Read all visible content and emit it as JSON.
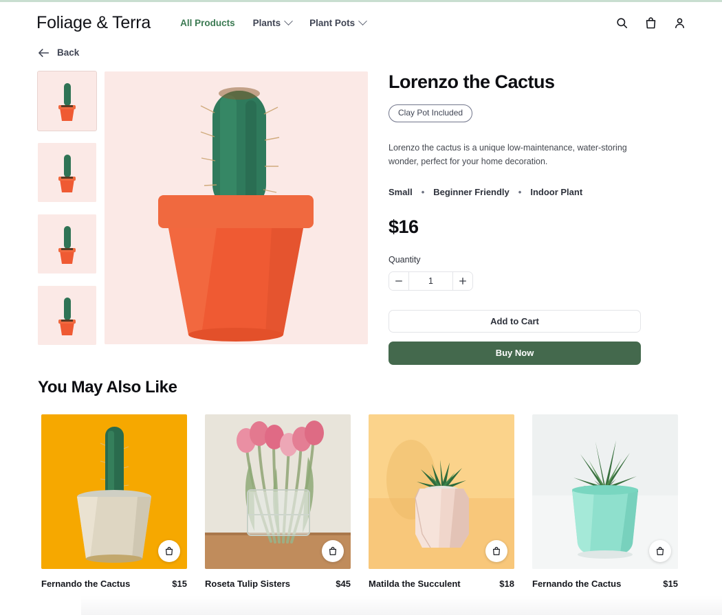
{
  "brand": "Foliage & Terra",
  "nav": {
    "items": [
      {
        "label": "All Products",
        "active": true,
        "caret": false
      },
      {
        "label": "Plants",
        "active": false,
        "caret": true
      },
      {
        "label": "Plant Pots",
        "active": false,
        "caret": true
      }
    ],
    "icons": [
      "search-icon",
      "shopping-bag-icon",
      "account-icon"
    ]
  },
  "back": {
    "label": "Back",
    "icon": "arrow-left-icon"
  },
  "gallery": {
    "thumbnail_count": 4,
    "selected_index": 0,
    "background": "#fbe9e6",
    "alt": "Green columnar cactus in an orange terracotta pot on a pale pink background"
  },
  "product": {
    "title": "Lorenzo the Cactus",
    "badge": "Clay Pot Included",
    "description": "Lorenzo the cactus is a unique low-maintenance, water-storing wonder, perfect for your home decoration.",
    "attributes": [
      "Small",
      "Beginner Friendly",
      "Indoor Plant"
    ],
    "attribute_separator": "•",
    "price": "$16",
    "quantity_label": "Quantity",
    "quantity_value": "1",
    "decrement_icon": "minus-icon",
    "increment_icon": "plus-icon",
    "add_to_cart_label": "Add to Cart",
    "buy_now_label": "Buy Now",
    "buy_now_color": "#44694d",
    "accent_color": "#3b7a52"
  },
  "related": {
    "heading": "You May Also Like",
    "fab_icon": "shopping-bag-icon",
    "items": [
      {
        "name": "Fernando the Cactus",
        "price": "$15",
        "bg": "#f6a800",
        "alt": "Tall cactus in a cream ceramic pot on a yellow background"
      },
      {
        "name": "Roseta Tulip Sisters",
        "price": "$45",
        "bg": "#e8e4da",
        "alt": "Pink tulips in a clear glass vase on a wooden table"
      },
      {
        "name": "Matilda the Succulent",
        "price": "$18",
        "bg": "#fbd38b",
        "alt": "Small succulent in a faceted blush geometric pot on a warm yellow background"
      },
      {
        "name": "Fernando the Cactus",
        "price": "$15",
        "bg": "#eef1f1",
        "alt": "Haworthia succulent in a mint green pot on a white background"
      }
    ]
  }
}
